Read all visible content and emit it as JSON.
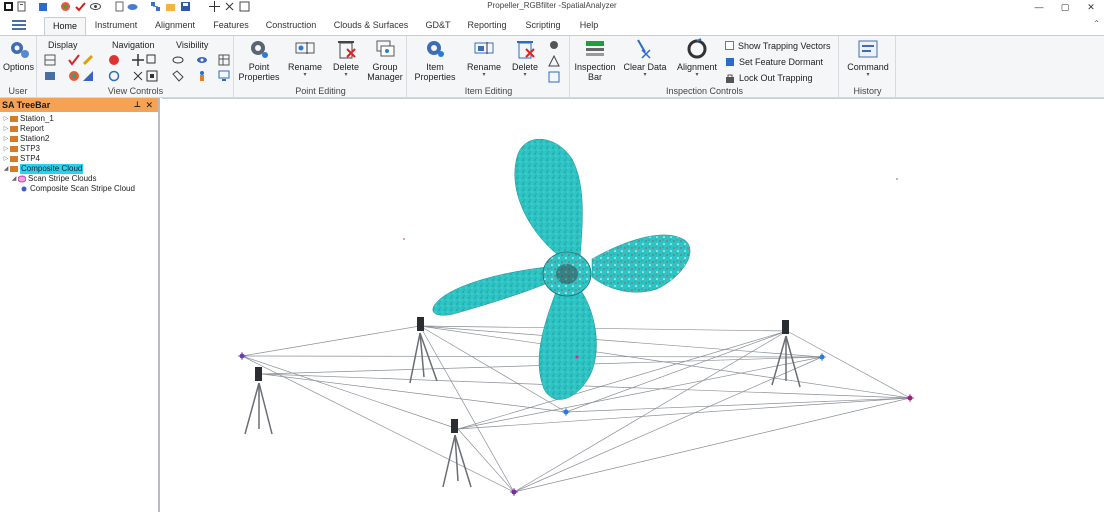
{
  "window": {
    "title": "Propeller_RGBfilter -SpatialAnalyzer",
    "minimize": "—",
    "maximize": "▢",
    "close": "✕"
  },
  "tabs": [
    {
      "label": "Home",
      "active": true
    },
    {
      "label": "Instrument"
    },
    {
      "label": "Alignment"
    },
    {
      "label": "Features"
    },
    {
      "label": "Construction"
    },
    {
      "label": "Clouds & Surfaces"
    },
    {
      "label": "GD&T"
    },
    {
      "label": "Reporting"
    },
    {
      "label": "Scripting"
    },
    {
      "label": "Help"
    }
  ],
  "ribbon": {
    "user": {
      "label": "User",
      "options_label": "Options"
    },
    "view_controls": {
      "label": "View Controls",
      "display_head": "Display",
      "navigation_head": "Navigation",
      "visibility_head": "Visibility"
    },
    "point_editing": {
      "label": "Point Editing",
      "point_properties": "Point\nProperties",
      "point_properties_l1": "Point",
      "point_properties_l2": "Properties",
      "rename": "Rename",
      "delete": "Delete",
      "group_manager_l1": "Group",
      "group_manager_l2": "Manager"
    },
    "item_editing": {
      "label": "Item Editing",
      "item_properties_l1": "Item",
      "item_properties_l2": "Properties",
      "rename": "Rename",
      "delete": "Delete"
    },
    "inspection_controls": {
      "label": "Inspection Controls",
      "inspection_bar_l1": "Inspection",
      "inspection_bar_l2": "Bar",
      "clear_data": "Clear Data",
      "alignment": "Alignment",
      "show_trapping_vectors": "Show Trapping Vectors",
      "set_feature_dormant": "Set Feature Dormant",
      "lock_out_trapping": "Lock Out Trapping"
    },
    "history": {
      "label": "History",
      "command": "Command"
    }
  },
  "treebar": {
    "title": "SA TreeBar",
    "pin": "🖈",
    "close": "✕",
    "items": [
      {
        "label": "Station_1"
      },
      {
        "label": "Report"
      },
      {
        "label": "Station2"
      },
      {
        "label": "STP3"
      },
      {
        "label": "STP4"
      },
      {
        "label": "Composite Cloud"
      },
      {
        "label": "Scan Stripe Clouds"
      },
      {
        "label": "Composite Scan Stripe Cloud"
      }
    ]
  },
  "colors": {
    "accent": "#2b7bd6",
    "tree_header": "#f5a255",
    "selection": "#27d2f5",
    "propeller": "#2ec4c4",
    "propeller_dark": "#1f8e94"
  }
}
